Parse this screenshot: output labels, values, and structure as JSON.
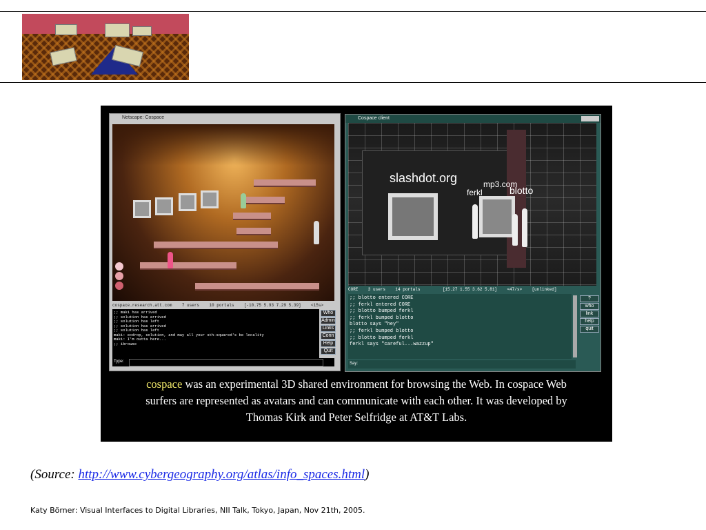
{
  "slide": {
    "source_prefix": "(Source: ",
    "source_url": "http://www.cybergeography.org/atlas/info_spaces.html",
    "source_suffix": ")",
    "footer": "Katy Börner: Visual Interfaces to Digital Libraries, NII Talk, Tokyo, Japan, Nov 21th, 2005."
  },
  "screenshot": {
    "left_window": {
      "title": "Netscape: Cospace",
      "status_bar": "cospace.research.att.com    7 users    10 portals    [-10.75 5.93 7.29 5.39]    <15s>",
      "chat_lines": [
        ";; maki has arrived",
        ";; solution has arrived",
        ";; solution has left",
        ";; solution has arrived",
        ";; solution has left",
        "maki: ecdrop, solution, and may all your sth-squared's be locality",
        "maki: I'm outta here...",
        ";; ibrowse"
      ],
      "buttons": [
        "Who",
        "Admin",
        "Links",
        "Conn",
        "Help",
        "Quit"
      ],
      "input_label": "Type:"
    },
    "right_window": {
      "title": "Cospace client",
      "scene_labels": [
        "slashdot.org",
        "ferkl",
        "mp3.com",
        "blotto"
      ],
      "status_bar": "CORE    3 users    14 portals         [15.27 1.55 3.62 5.81]    <47/s>    [unlinked]",
      "chat_lines": [
        ";; blotto entered CORE",
        ";; ferkl entered CORE",
        ";; blotto bumped ferkl",
        ";; ferkl bumped blotto",
        "blotto says \"hey\"",
        ";; ferkl bumped blotto",
        ";; blotto bumped ferkl",
        "ferkl says \"careful...wazzup\""
      ],
      "buttons": [
        "?",
        "who",
        "link",
        "help",
        "quit"
      ],
      "input_label": "Say:"
    },
    "caption": {
      "highlight": "cospace",
      "line1": " was an experimental 3D shared environment for browsing the Web. In cospace Web",
      "line2": "surfers are represented as avatars and can communicate with each other. It was developed by",
      "line3": "Thomas Kirk and Peter Selfridge at AT&T Labs."
    }
  },
  "colors": {
    "caption_highlight": "#f2e96a",
    "link": "#1a2ae6",
    "panel_bg": "#000000",
    "chat_teal": "#1f4a44"
  }
}
